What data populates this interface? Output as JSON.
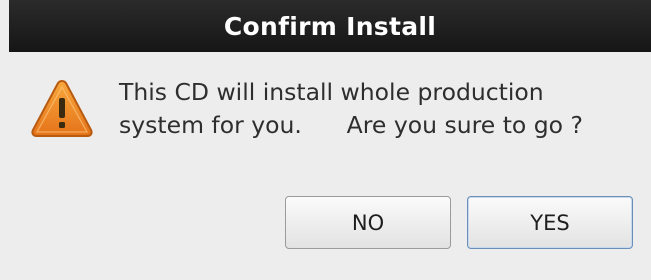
{
  "dialog": {
    "title": "Confirm Install",
    "icon": "warning-icon",
    "message_line1": "This CD will install whole production",
    "message_line2": "system for you.      Are you sure to go ?",
    "buttons": {
      "no_label": "NO",
      "yes_label": "YES"
    },
    "colors": {
      "titlebar": "#1c1c1c",
      "background": "#ededed",
      "warning": "#f28c1e",
      "default_button_border": "#6b8fb8"
    }
  }
}
